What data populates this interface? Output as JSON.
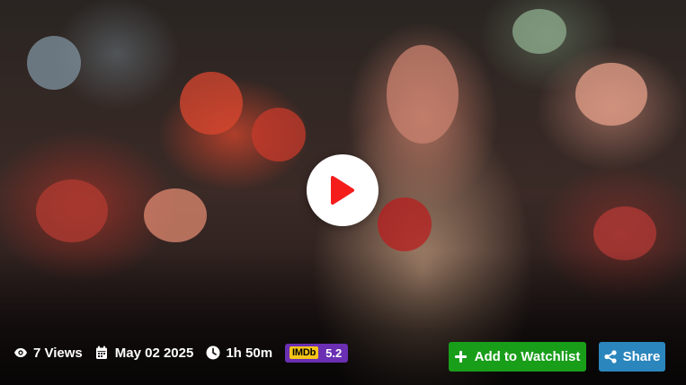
{
  "player": {
    "views": "7 Views",
    "date": "May 02 2025",
    "duration": "1h 50m",
    "imdb_logo": "IMDb",
    "imdb_rating": "5.2"
  },
  "actions": {
    "watchlist_label": "Add to Watchlist",
    "share_label": "Share"
  },
  "icons": {
    "play": "play-icon",
    "views": "eye-icon",
    "date": "calendar-icon",
    "duration": "clock-icon",
    "watchlist": "plus-icon",
    "share": "share-icon"
  },
  "colors": {
    "play_accent": "#f51c1c",
    "watchlist_bg": "#199e1a",
    "share_bg": "#2b86bd",
    "imdb_badge_bg": "#6a2fb3",
    "imdb_logo_bg": "#f5c518"
  }
}
